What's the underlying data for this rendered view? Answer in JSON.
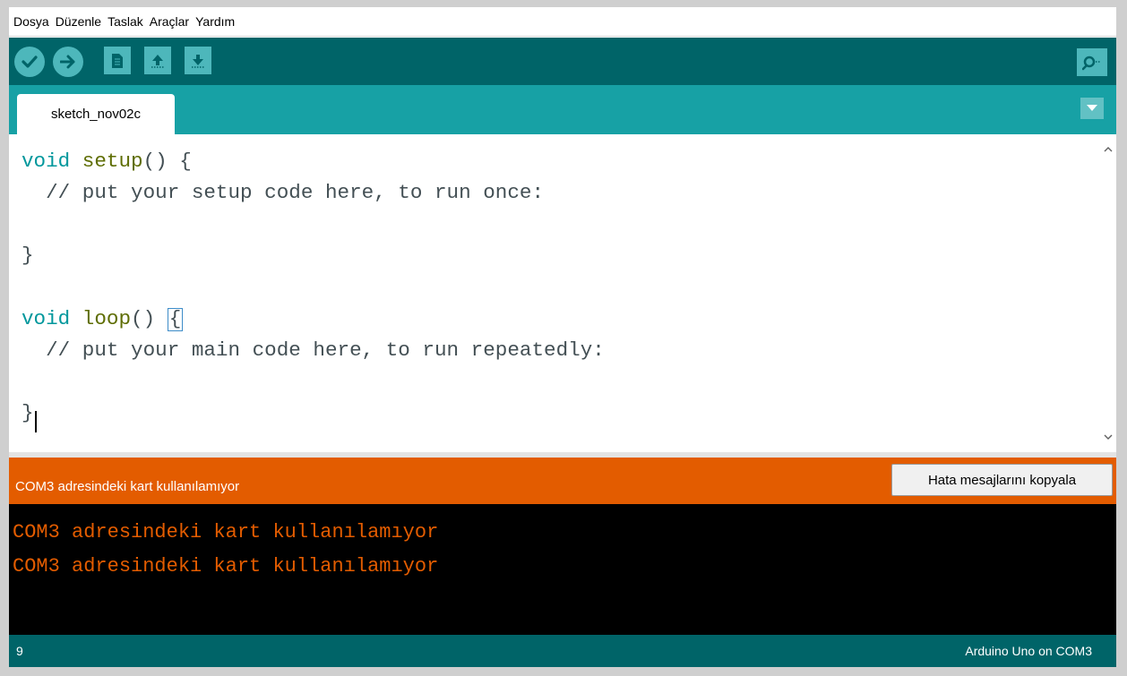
{
  "menu": {
    "items": [
      "Dosya",
      "Düzenle",
      "Taslak",
      "Araçlar",
      "Yardım"
    ]
  },
  "toolbar": {
    "buttons": [
      "verify-icon",
      "upload-icon",
      "new-icon",
      "open-icon",
      "save-icon"
    ],
    "serial_monitor": "serial-monitor-icon"
  },
  "tabs": {
    "active": "sketch_nov02c"
  },
  "editor": {
    "lines": [
      {
        "kw": "void",
        "fn": "setup",
        "rest": "() {"
      },
      {
        "comment": "  // put your setup code here, to run once:"
      },
      {
        "text": ""
      },
      {
        "text": "}"
      },
      {
        "text": ""
      },
      {
        "kw": "void",
        "fn": "loop",
        "rest": "() ",
        "brace": "{"
      },
      {
        "comment": "  // put your main code here, to run repeatedly:"
      },
      {
        "text": ""
      },
      {
        "text": "}"
      }
    ]
  },
  "status": {
    "message": "COM3 adresindeki kart kullanılamıyor",
    "copy_button": "Hata mesajlarını kopyala"
  },
  "console": {
    "lines": [
      "COM3 adresindeki kart kullanılamıyor",
      "COM3 adresindeki kart kullanılamıyor"
    ]
  },
  "footer": {
    "line_number": "9",
    "board": "Arduino Uno on COM3"
  },
  "colors": {
    "toolbar_bg": "#006468",
    "tabbar_bg": "#17a1a5",
    "button_bg": "#4db7bb",
    "status_bg": "#e35c00",
    "console_text": "#e35c00",
    "keyword": "#00979c",
    "function": "#5e6d03"
  }
}
